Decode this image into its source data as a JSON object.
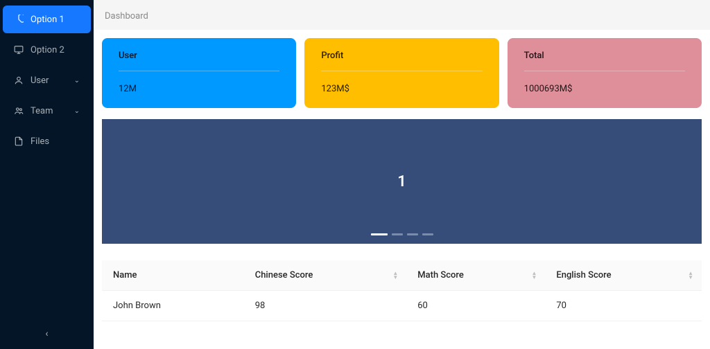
{
  "sidebar": {
    "items": [
      {
        "label": "Option 1",
        "icon": "pie-chart-icon",
        "active": true
      },
      {
        "label": "Option 2",
        "icon": "desktop-icon"
      },
      {
        "label": "User",
        "icon": "user-icon",
        "submenu": true
      },
      {
        "label": "Team",
        "icon": "team-icon",
        "submenu": true
      },
      {
        "label": "Files",
        "icon": "file-icon"
      }
    ]
  },
  "breadcrumb": [
    "Dashboard"
  ],
  "cards": [
    {
      "title": "User",
      "value": "12M",
      "color": "#0099ff"
    },
    {
      "title": "Profit",
      "value": "123M$",
      "color": "#ffbf00"
    },
    {
      "title": "Total",
      "value": "1000693M$",
      "color": "#de8f99"
    }
  ],
  "carousel": {
    "current": "1",
    "total": 4,
    "activeIndex": 0
  },
  "table": {
    "columns": [
      "Name",
      "Chinese Score",
      "Math Score",
      "English Score"
    ],
    "rows": [
      {
        "name": "John Brown",
        "chinese": "98",
        "math": "60",
        "english": "70"
      }
    ]
  }
}
